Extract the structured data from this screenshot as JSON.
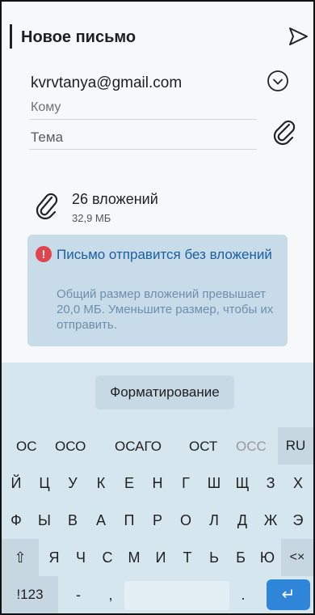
{
  "header": {
    "title": "Новое письмо",
    "send_icon": "send-icon"
  },
  "fields": {
    "email": "kvrvtanya@gmail.com",
    "to_label": "Кому",
    "subject_placeholder": "Тема"
  },
  "attachments": {
    "count_label": "26 вложений",
    "size_label": "32,9 МБ"
  },
  "warning": {
    "title": "Письмо отправится без вложений",
    "text": "Общий размер вложений превышает 20,0 МБ. Уменьшите размер, чтобы их отправить.",
    "icon_symbol": "!"
  },
  "keyboard": {
    "format_label": "Форматирование",
    "suggestions": [
      "ОС",
      "ОСО",
      "ОСАГО",
      "ОСТ",
      "ОСС"
    ],
    "lang_label": "RU",
    "row1": [
      "Й",
      "Ц",
      "У",
      "К",
      "Е",
      "Н",
      "Г",
      "Ш",
      "Щ",
      "З",
      "Х"
    ],
    "row2": [
      "Ф",
      "Ы",
      "В",
      "А",
      "П",
      "Р",
      "О",
      "Л",
      "Д",
      "Ж",
      "Э"
    ],
    "row3": [
      "Я",
      "Ч",
      "С",
      "М",
      "И",
      "Т",
      "Ь",
      "Б",
      "Ю"
    ],
    "shift_symbol": "⇧",
    "backspace_symbol": "<×",
    "num_label": "!123",
    "dash_label": "-",
    "comma_label": ",",
    "dot_label": ".",
    "enter_symbol": "↵"
  },
  "colors": {
    "accent": "#2f86d8",
    "warning_bg": "#c8dbe8",
    "warning_title": "#1b5fa3",
    "error": "#e0454e"
  }
}
